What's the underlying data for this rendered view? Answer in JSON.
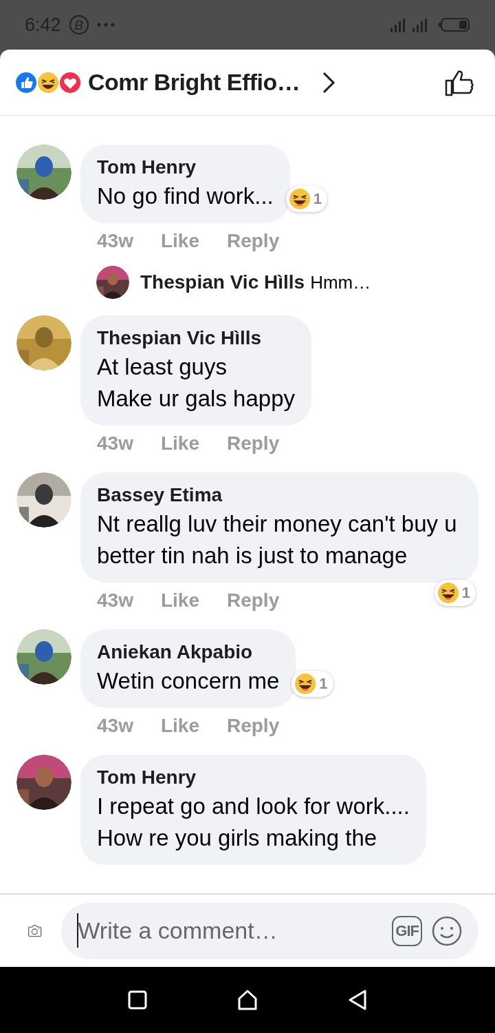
{
  "status_bar": {
    "time": "6:42",
    "badge": "B"
  },
  "header": {
    "title": "Comr Bright Effio…"
  },
  "comments": [
    {
      "kind": "comment",
      "name": "Tom Henry",
      "text": "No go find work...",
      "reaction": {
        "count": "1"
      },
      "time": "43w",
      "like": "Like",
      "reply": "Reply"
    },
    {
      "kind": "reply_preview",
      "name": "Thespian Vic Hìlls",
      "text": "Hmm…"
    },
    {
      "kind": "comment",
      "name": "Thespian Vic Hìlls",
      "text": "At least guys\nMake ur gals happy",
      "time": "43w",
      "like": "Like",
      "reply": "Reply"
    },
    {
      "kind": "comment",
      "name": "Bassey Etima",
      "text": "Nt reallg luv their money can't buy u better tin nah is just to manage",
      "reaction": {
        "count": "1"
      },
      "time": "43w",
      "like": "Like",
      "reply": "Reply"
    },
    {
      "kind": "comment",
      "name": "Aniekan Akpabio",
      "text": "Wetin concern me",
      "reaction": {
        "count": "1"
      },
      "time": "43w",
      "like": "Like",
      "reply": "Reply"
    },
    {
      "kind": "comment",
      "name": "Tom Henry",
      "text": "I repeat go and look for work....\nHow re you girls making the"
    }
  ],
  "composer": {
    "placeholder": "Write a comment…",
    "gif": "GIF"
  }
}
